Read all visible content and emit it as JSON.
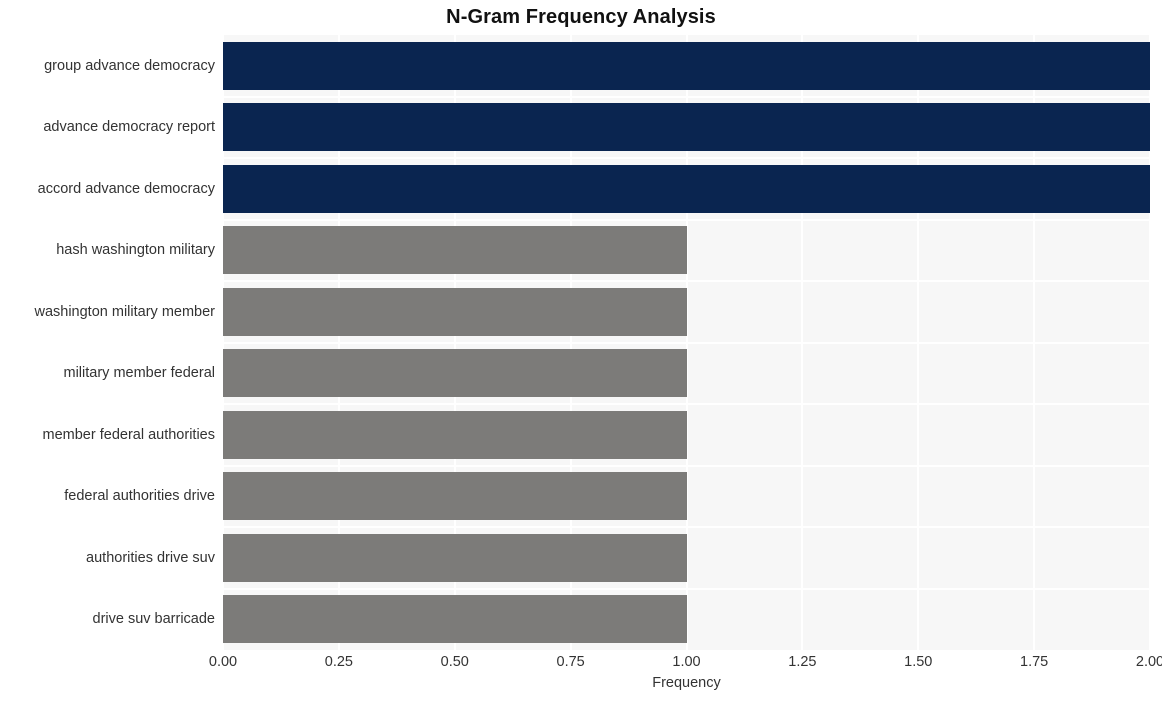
{
  "chart": {
    "title": "N-Gram Frequency Analysis",
    "xlabel": "Frequency",
    "ylabel": ""
  },
  "chart_data": {
    "type": "bar",
    "orientation": "horizontal",
    "title": "N-Gram Frequency Analysis",
    "xlabel": "Frequency",
    "ylabel": "",
    "categories": [
      "group advance democracy",
      "advance democracy report",
      "accord advance democracy",
      "hash washington military",
      "washington military member",
      "military member federal",
      "member federal authorities",
      "federal authorities drive",
      "authorities drive suv",
      "drive suv barricade"
    ],
    "values": [
      2,
      2,
      2,
      1,
      1,
      1,
      1,
      1,
      1,
      1
    ],
    "bar_colors": [
      "#0a2550",
      "#0a2550",
      "#0a2550",
      "#7c7b79",
      "#7c7b79",
      "#7c7b79",
      "#7c7b79",
      "#7c7b79",
      "#7c7b79",
      "#7c7b79"
    ],
    "xlim": [
      0,
      2
    ],
    "xticks": [
      0,
      0.25,
      0.5,
      0.75,
      1,
      1.25,
      1.5,
      1.75,
      2
    ],
    "xtick_labels": [
      "0.00",
      "0.25",
      "0.50",
      "0.75",
      "1.00",
      "1.25",
      "1.50",
      "1.75",
      "2.00"
    ],
    "grid": true,
    "grid_color": "#ffffff",
    "plot_background": "#f7f7f7",
    "legend": null
  },
  "colors": {
    "accent_navy": "#0a2550",
    "accent_gray": "#7c7b79",
    "plot_bg": "#f7f7f7",
    "grid": "#ffffff",
    "text": "#333333",
    "title": "#111111"
  }
}
